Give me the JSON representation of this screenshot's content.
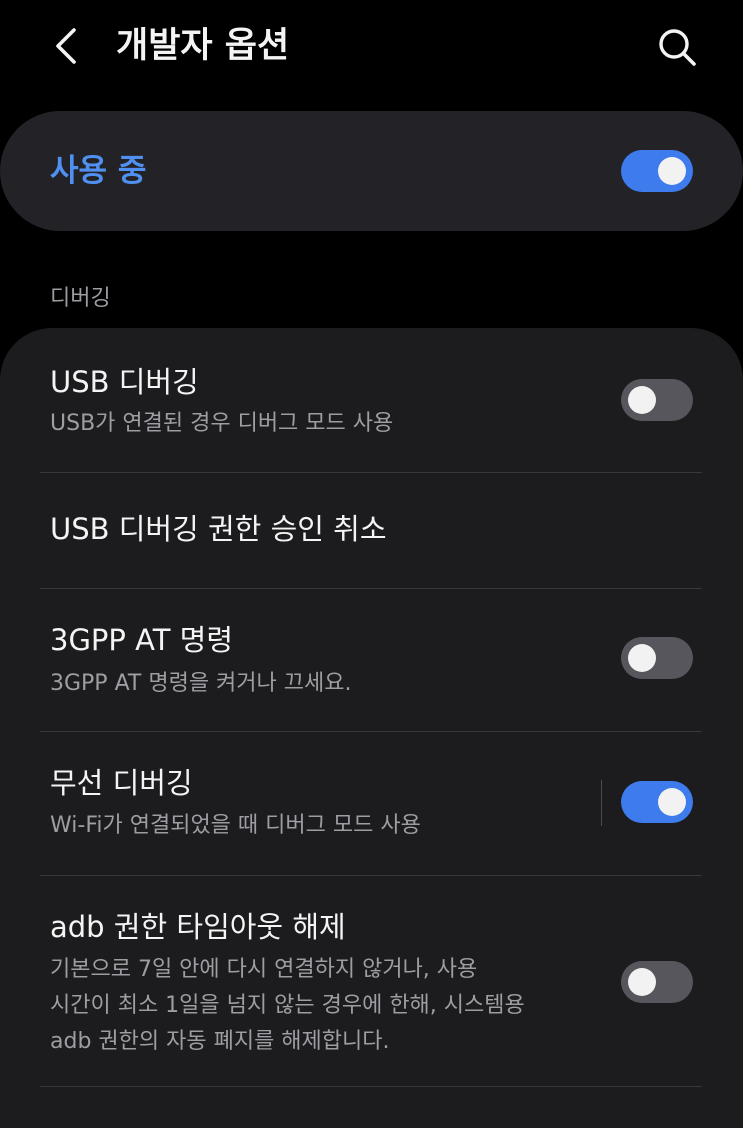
{
  "header": {
    "title": "개발자 옵션",
    "back_icon": "chevron-left-icon",
    "search_icon": "search-icon"
  },
  "master_switch": {
    "label": "사용 중",
    "state": "on"
  },
  "section": {
    "title": "디버깅"
  },
  "items": [
    {
      "title": "USB 디버깅",
      "subtitle": "USB가 연결된 경우 디버그 모드 사용",
      "toggle": "off"
    },
    {
      "title": "USB 디버깅 권한 승인 취소"
    },
    {
      "title": "3GPP AT 명령",
      "subtitle": "3GPP AT 명령을 켜거나 끄세요.",
      "toggle": "off"
    },
    {
      "title": "무선 디버깅",
      "subtitle": "Wi-Fi가 연결되었을 때 디버그 모드 사용",
      "toggle": "on"
    },
    {
      "title": "adb 권한 타임아웃 해제",
      "subtitle_lines": [
        "기본으로 7일 안에 다시 연결하지 않거나, 사용",
        "시간이 최소 1일을 넘지 않는 경우에 한해, 시스템용",
        "adb 권한의 자동 폐지를 해제합니다."
      ],
      "toggle": "off"
    }
  ],
  "colors": {
    "background": "#000000",
    "card": "#1c1c1e",
    "master_card": "#232327",
    "accent": "#4f90f0",
    "switch_on": "#3e7bed",
    "switch_off": "#56565c",
    "text_primary": "#f4f4f4",
    "text_secondary": "#9d9da3"
  }
}
